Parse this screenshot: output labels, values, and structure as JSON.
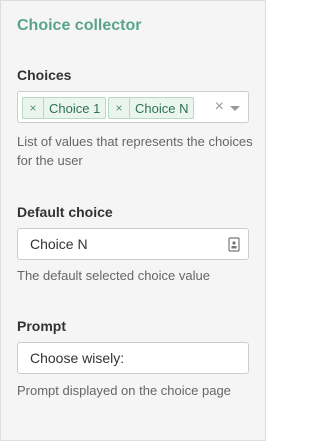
{
  "panel": {
    "title": "Choice collector"
  },
  "fields": {
    "choices": {
      "label": "Choices",
      "selected_tags": [
        {
          "remove_glyph": "×",
          "label": "Choice 1"
        },
        {
          "remove_glyph": "×",
          "label": "Choice N"
        }
      ],
      "clear_glyph": "×",
      "help": "List of values that represents the choices for the user"
    },
    "default_choice": {
      "label": "Default choice",
      "value": "Choice N",
      "icon": "contact-card-icon",
      "help": "The default selected choice value"
    },
    "prompt": {
      "label": "Prompt",
      "value": "Choose wisely:",
      "help": "Prompt displayed on the choice page"
    }
  },
  "colors": {
    "title": "#5aa58a",
    "tag_bg": "#eaf5ef",
    "tag_border": "#b7d9c6",
    "panel_bg": "#f5f5f5"
  }
}
